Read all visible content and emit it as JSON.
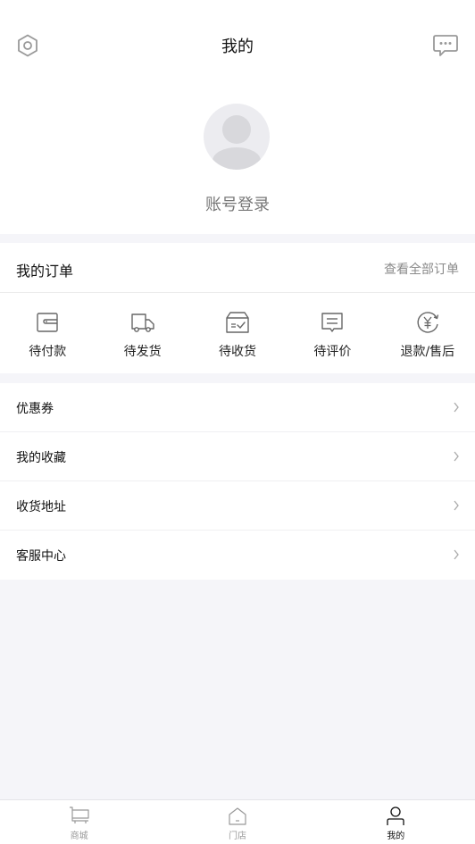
{
  "header": {
    "title": "我的",
    "settings_icon": "settings-icon",
    "message_icon": "message-icon"
  },
  "profile": {
    "avatar_icon": "avatar-icon",
    "login_label": "账号登录"
  },
  "orders": {
    "title": "我的订单",
    "view_all": "查看全部订单",
    "items": [
      {
        "label": "待付款",
        "icon": "wallet-icon"
      },
      {
        "label": "待发货",
        "icon": "truck-icon"
      },
      {
        "label": "待收货",
        "icon": "box-icon"
      },
      {
        "label": "待评价",
        "icon": "comment-icon"
      },
      {
        "label": "退款/售后",
        "icon": "refund-icon"
      }
    ]
  },
  "menu": {
    "items": [
      {
        "label": "优惠券"
      },
      {
        "label": "我的收藏"
      },
      {
        "label": "收货地址"
      },
      {
        "label": "客服中心"
      }
    ]
  },
  "tabbar": {
    "items": [
      {
        "label": "商城",
        "icon": "cart-icon"
      },
      {
        "label": "门店",
        "icon": "store-icon"
      },
      {
        "label": "我的",
        "icon": "user-icon"
      }
    ],
    "active_index": 2
  }
}
